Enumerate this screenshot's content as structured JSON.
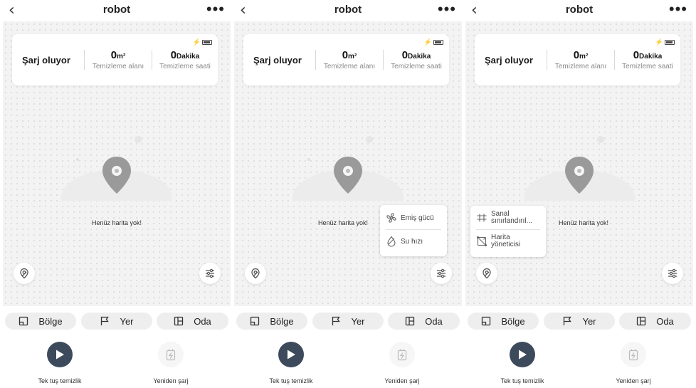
{
  "screens": [
    {
      "nav": {
        "back_glyph": "‹",
        "title": "robot",
        "more_glyph": "•••"
      },
      "status_card": {
        "status": "Şarj oluyor",
        "area_value": "0",
        "area_unit": "m²",
        "area_label": "Temizleme alanı",
        "time_value": "0",
        "time_unit": "Dakika",
        "time_label": "Temizleme saati"
      },
      "map": {
        "empty_text": "Henüz harita yok!"
      },
      "popup": null,
      "tabs": [
        "Bölge",
        "Yer",
        "Oda"
      ],
      "actions": {
        "clean": "Tek tuş temizlik",
        "recharge": "Yeniden şarj"
      }
    },
    {
      "nav": {
        "back_glyph": "‹",
        "title": "robot",
        "more_glyph": "•••"
      },
      "status_card": {
        "status": "Şarj oluyor",
        "area_value": "0",
        "area_unit": "m²",
        "area_label": "Temizleme alanı",
        "time_value": "0",
        "time_unit": "Dakika",
        "time_label": "Temizleme saati"
      },
      "map": {
        "empty_text": "Henüz harita yok!"
      },
      "popup": {
        "items": [
          {
            "icon": "fan-icon",
            "label": "Emiş gücü"
          },
          {
            "icon": "water-drop-icon",
            "label": "Su hızı"
          }
        ]
      },
      "tabs": [
        "Bölge",
        "Yer",
        "Oda"
      ],
      "actions": {
        "clean": "Tek tuş temizlik",
        "recharge": "Yeniden şarj"
      }
    },
    {
      "nav": {
        "back_glyph": "‹",
        "title": "robot",
        "more_glyph": "•••"
      },
      "status_card": {
        "status": "Şarj oluyor",
        "area_value": "0",
        "area_unit": "m²",
        "area_label": "Temizleme alanı",
        "time_value": "0",
        "time_unit": "Dakika",
        "time_label": "Temizleme saati"
      },
      "map": {
        "empty_text": "Henüz harita yok!"
      },
      "popup": {
        "items": [
          {
            "icon": "virtual-wall-icon",
            "label_line1": "Sanal",
            "label_line2": "sınırlandırıl..."
          },
          {
            "icon": "map-manager-icon",
            "label_line1": "Harita",
            "label_line2": "yöneticisi"
          }
        ]
      },
      "tabs": [
        "Bölge",
        "Yer",
        "Oda"
      ],
      "actions": {
        "clean": "Tek tuş temizlik",
        "recharge": "Yeniden şarj"
      }
    }
  ],
  "colors": {
    "play_button": "#3c4a5c",
    "map_background": "#f3f3f3",
    "pin": "#9a9a9a"
  }
}
